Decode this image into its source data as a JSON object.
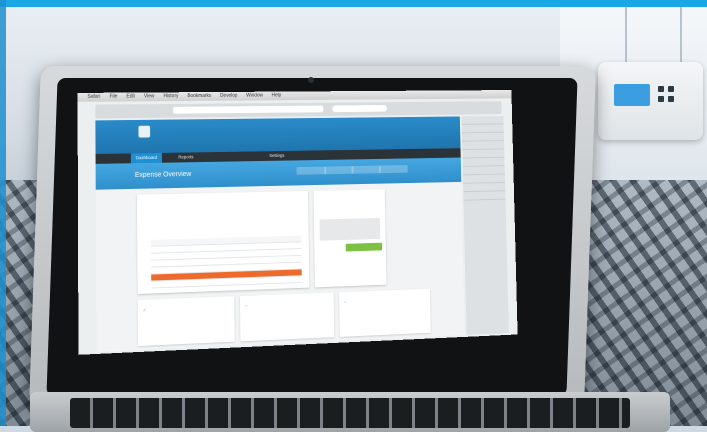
{
  "scene": {
    "description_free": true
  },
  "browser": {
    "menu": [
      "Safari",
      "File",
      "Edit",
      "View",
      "History",
      "Bookmarks",
      "Develop",
      "Window",
      "Help"
    ],
    "url": ""
  },
  "site": {
    "logo_text": "",
    "welcome": "",
    "nav": [
      {
        "label": "Dashboard",
        "active": true
      },
      {
        "label": "Reports",
        "active": false
      },
      {
        "label": "",
        "active": false
      },
      {
        "label": "Settings",
        "active": false
      }
    ],
    "page_title": "Expense Overview",
    "band_buttons": [
      "",
      "",
      "",
      ""
    ]
  },
  "main_card": {
    "status_label": "",
    "title": "",
    "subtitle": "",
    "status": "",
    "amount": "",
    "table_rows": [
      {
        "kind": "hdr"
      },
      {
        "kind": "row"
      },
      {
        "kind": "row"
      },
      {
        "kind": "row"
      },
      {
        "kind": "row"
      },
      {
        "kind": "hl"
      },
      {
        "kind": "row"
      }
    ]
  },
  "side_panel": {
    "title": "",
    "button": ""
  },
  "bottom_cards": [
    {
      "title": "",
      "sub": ""
    },
    {
      "title": "",
      "sub": ""
    },
    {
      "title": "",
      "sub": ""
    }
  ],
  "colors": {
    "accent_blue": "#2a8bc9",
    "nav_active": "#1d8fd5",
    "highlight_row": "#ec6a2b",
    "approve_green": "#7dc242",
    "top_strip": "#1aa7e6"
  }
}
